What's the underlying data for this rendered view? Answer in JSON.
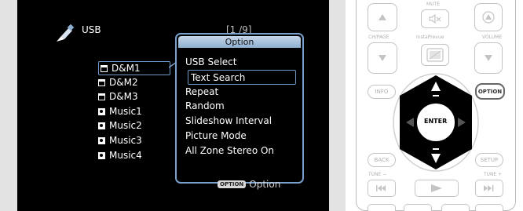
{
  "screen": {
    "source_label": "USB",
    "page_counter": "[1 /9]",
    "items": [
      {
        "label": "D&M1",
        "type": "folder"
      },
      {
        "label": "D&M2",
        "type": "folder"
      },
      {
        "label": "D&M3",
        "type": "folder"
      },
      {
        "label": "Music1",
        "type": "music"
      },
      {
        "label": "Music2",
        "type": "music"
      },
      {
        "label": "Music3",
        "type": "music"
      },
      {
        "label": "Music4",
        "type": "music"
      }
    ],
    "option_dialog": {
      "title": "Option",
      "items": [
        "USB Select",
        "Text Search",
        "Repeat",
        "Random",
        "Slideshow Interval",
        "Picture Mode",
        "All Zone Stereo On"
      ],
      "selected_index": 1
    },
    "bottom_hint": {
      "chip": "OPTION",
      "label": "Option"
    }
  },
  "remote": {
    "mute": "MUTE",
    "ch_page": "CH/PAGE",
    "insta_prevue": "InstaPrevue",
    "volume": "VOLUME",
    "info": "INFO",
    "option": "OPTION",
    "enter": "ENTER",
    "back": "BACK",
    "setup": "SETUP",
    "tune_minus": "TUNE −",
    "tune_plus": "TUNE +"
  },
  "colors": {
    "accent": "#6f99c6",
    "screen_bg": "#000000",
    "header": "#a9c2dd"
  }
}
